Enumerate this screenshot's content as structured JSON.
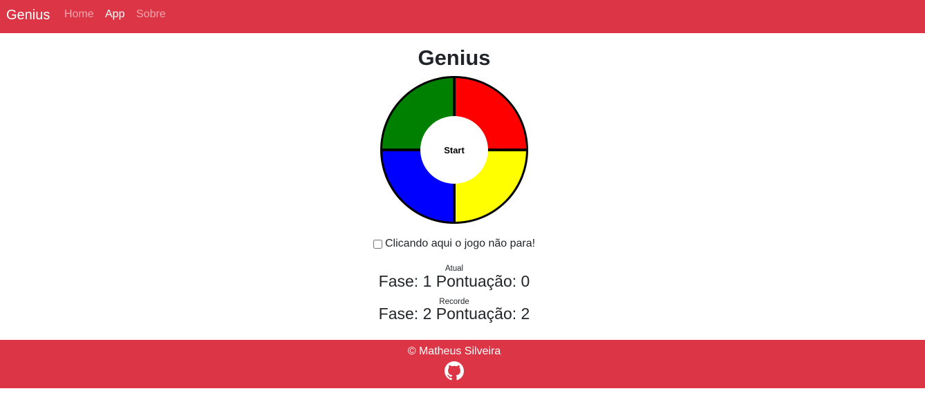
{
  "navbar": {
    "brand": "Genius",
    "links": [
      {
        "label": "Home",
        "active": false
      },
      {
        "label": "App",
        "active": true
      },
      {
        "label": "Sobre",
        "active": false
      }
    ],
    "background": "#dc3545"
  },
  "main": {
    "title": "Genius",
    "game": {
      "colors": {
        "green": "#008000",
        "red": "#ff0000",
        "blue": "#0000ff",
        "yellow": "#ffff00"
      },
      "start_label": "Start"
    },
    "option": {
      "checked": false,
      "label": "Clicando aqui o jogo não para!"
    },
    "current": {
      "label": "Atual",
      "phase_text": "Fase: 1",
      "score_text": "Pontuação: 0"
    },
    "record": {
      "label": "Recorde",
      "phase_text": "Fase: 2",
      "score_text": "Pontuação: 2"
    }
  },
  "footer": {
    "copyright": "© Matheus Silveira",
    "icon": "github-icon"
  }
}
